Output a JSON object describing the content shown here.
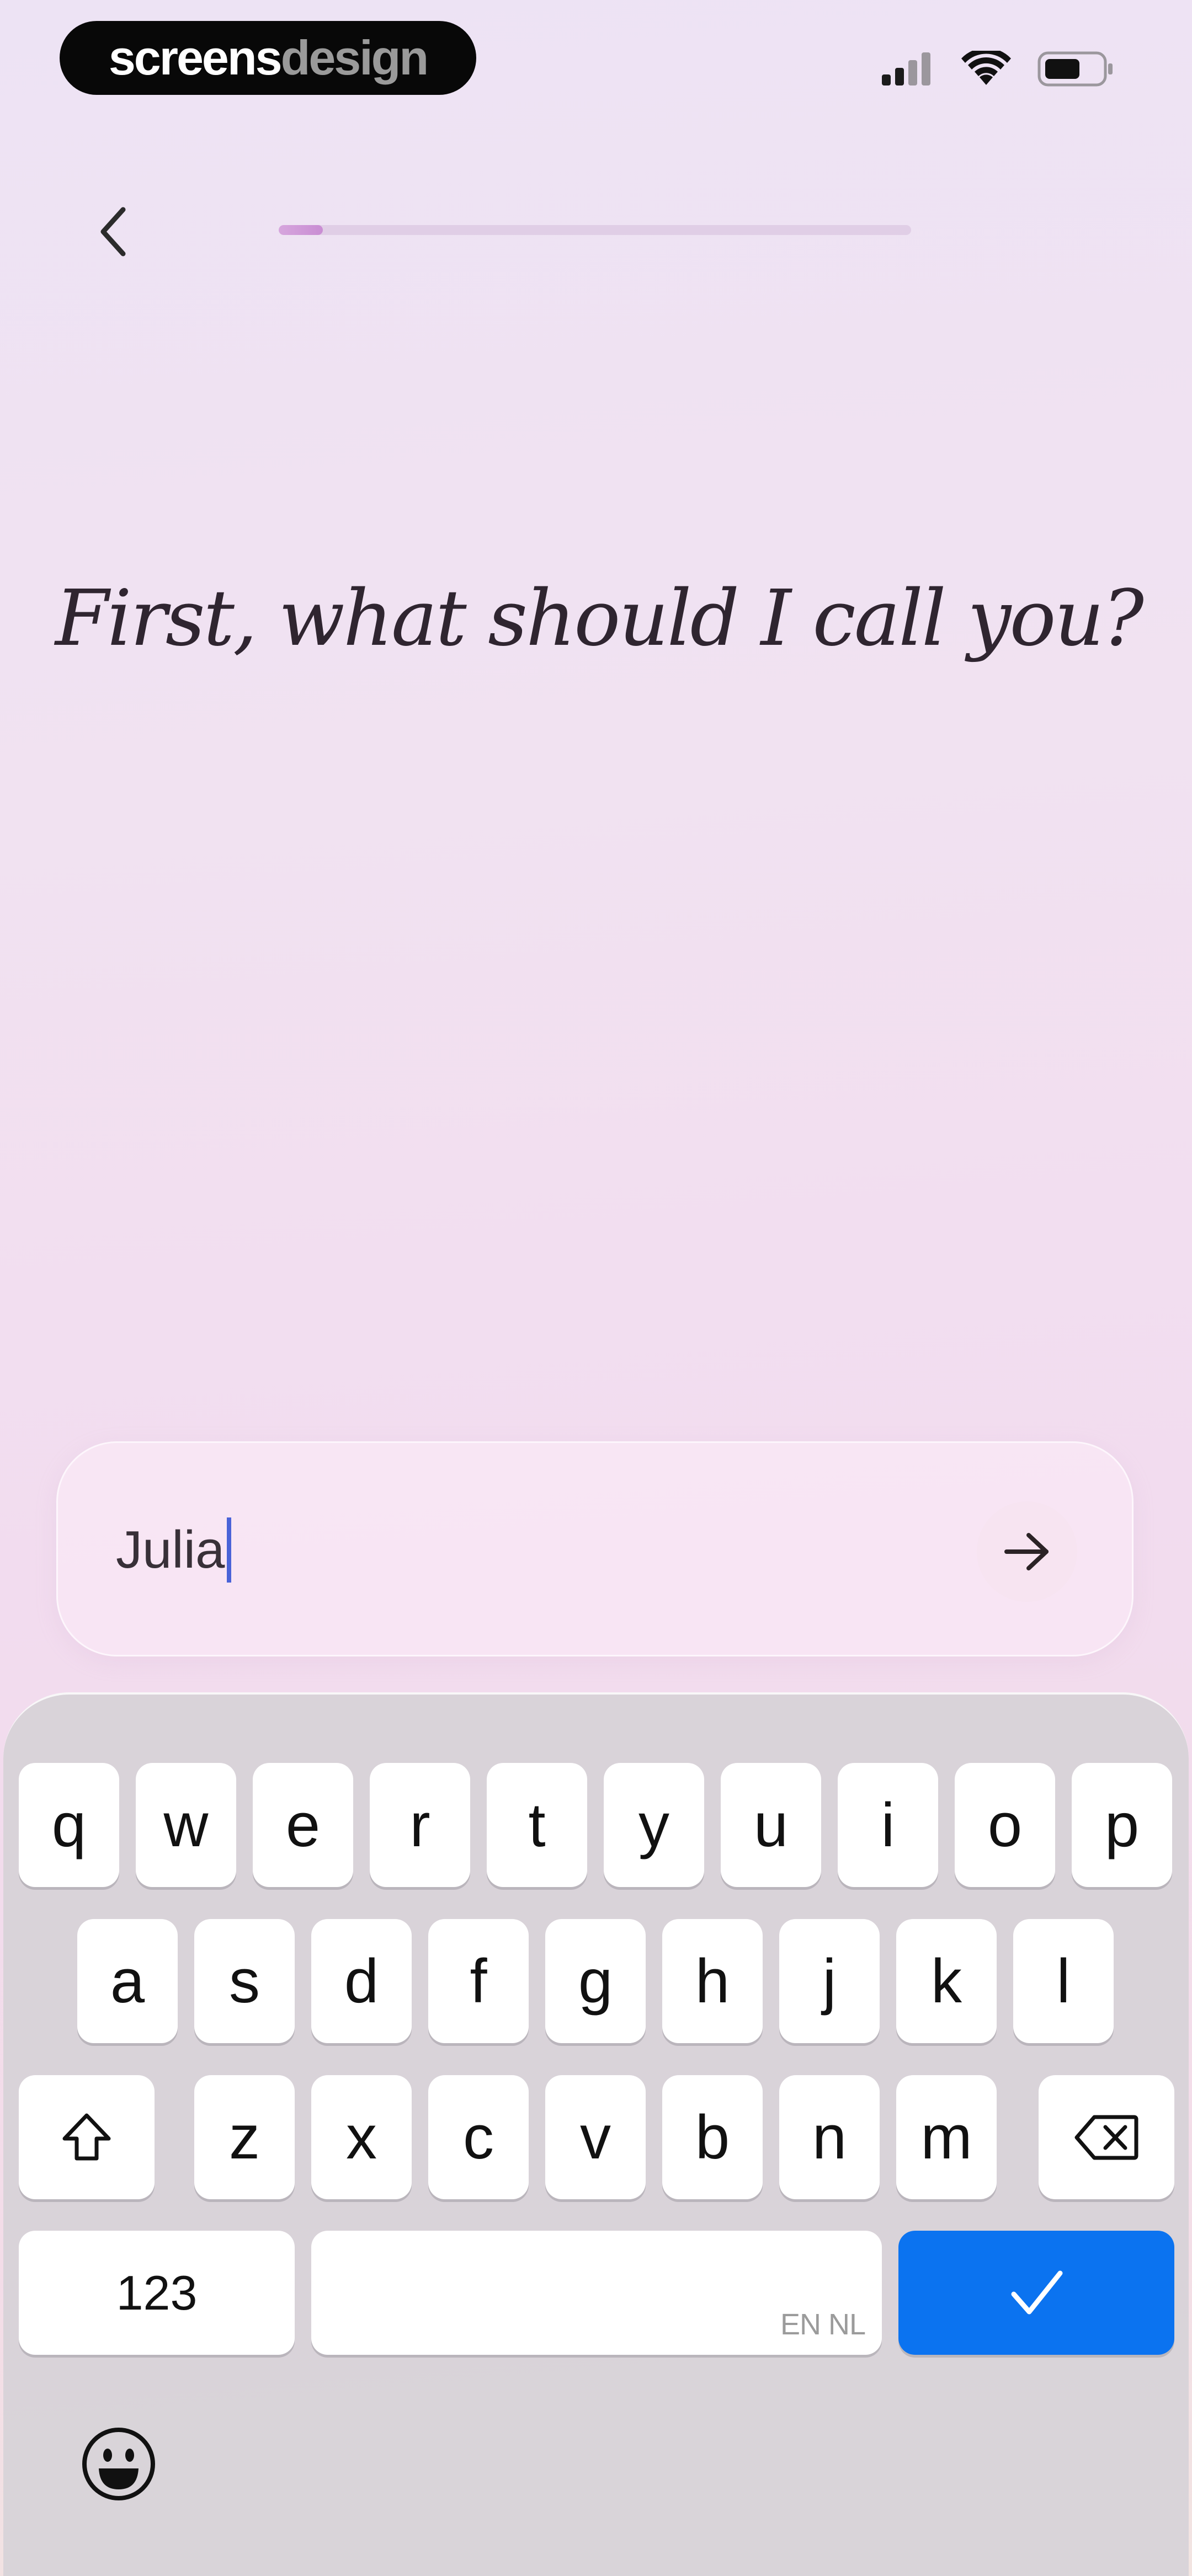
{
  "status_bar": {
    "brand_part1": "screens",
    "brand_part2": "design"
  },
  "nav": {
    "progress_fraction": 0.07
  },
  "heading": "First, what should I call you?",
  "name_input": {
    "value": "Julia"
  },
  "keyboard": {
    "row1": [
      "q",
      "w",
      "e",
      "r",
      "t",
      "y",
      "u",
      "i",
      "o",
      "p"
    ],
    "row2": [
      "a",
      "s",
      "d",
      "f",
      "g",
      "h",
      "j",
      "k",
      "l"
    ],
    "row3": [
      "z",
      "x",
      "c",
      "v",
      "b",
      "n",
      "m"
    ],
    "numbers_label": "123",
    "space_hint": "EN NL"
  },
  "colors": {
    "accent_blue": "#0b73f0",
    "caret": "#4a63d8"
  },
  "icons": {
    "back": "chevron-left-icon",
    "send": "arrow-right-icon",
    "shift": "shift-icon",
    "delete": "backspace-icon",
    "done": "checkmark-icon",
    "emoji": "emoji-icon"
  }
}
